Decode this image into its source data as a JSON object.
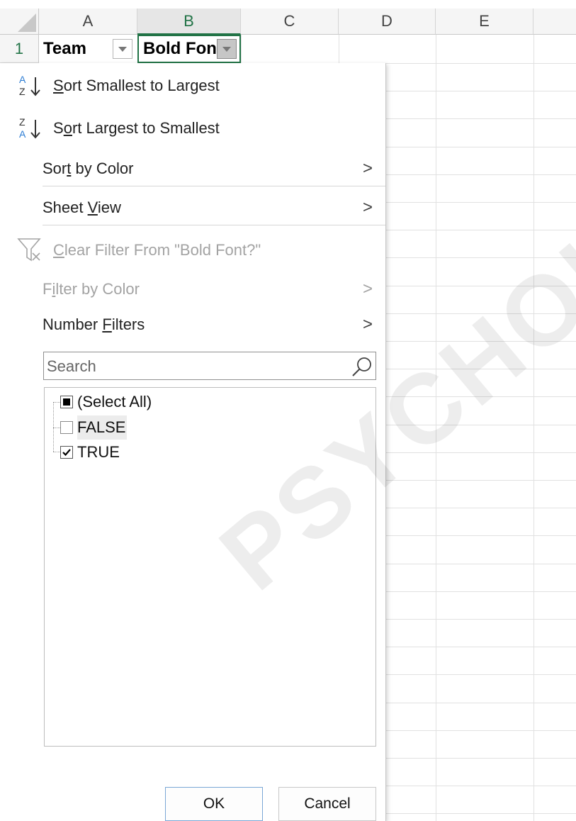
{
  "sheet": {
    "columns": [
      "A",
      "B",
      "C",
      "D",
      "E"
    ],
    "row_numbers": [
      "1"
    ],
    "selected_column": "B",
    "cells": {
      "A1": "Team",
      "B1": "Bold Fon"
    }
  },
  "menu": {
    "sort_asc": {
      "pre": "",
      "u": "S",
      "post": "ort Smallest to Largest",
      "icon": "sort-ascending-icon"
    },
    "sort_desc": {
      "pre": "S",
      "u": "o",
      "post": "rt Largest to Smallest",
      "icon": "sort-descending-icon"
    },
    "sort_by_color": {
      "pre": "Sor",
      "u": "t",
      "post": " by Color"
    },
    "sheet_view": {
      "pre": "Sheet ",
      "u": "V",
      "post": "iew"
    },
    "clear_filter": {
      "pre": "",
      "u": "C",
      "post": "lear Filter From \"Bold Font?\"",
      "icon": "clear-filter-icon"
    },
    "filter_by_color": {
      "pre": "F",
      "u": "i",
      "post": "lter by Color"
    },
    "number_filters": {
      "pre": "Number ",
      "u": "F",
      "post": "ilters"
    },
    "submenu_glyph": ">",
    "search": {
      "placeholder": "Search"
    },
    "values": [
      {
        "label": "(Select All)",
        "state": "partial"
      },
      {
        "label": "FALSE",
        "state": "unchecked"
      },
      {
        "label": "TRUE",
        "state": "checked"
      }
    ],
    "ok_label": "OK",
    "cancel_label": "Cancel"
  },
  "watermark": "PSYCHOLO",
  "colors": {
    "accent": "#217346",
    "disabled": "#a3a3a3",
    "ok_border": "#7aa7d6"
  }
}
